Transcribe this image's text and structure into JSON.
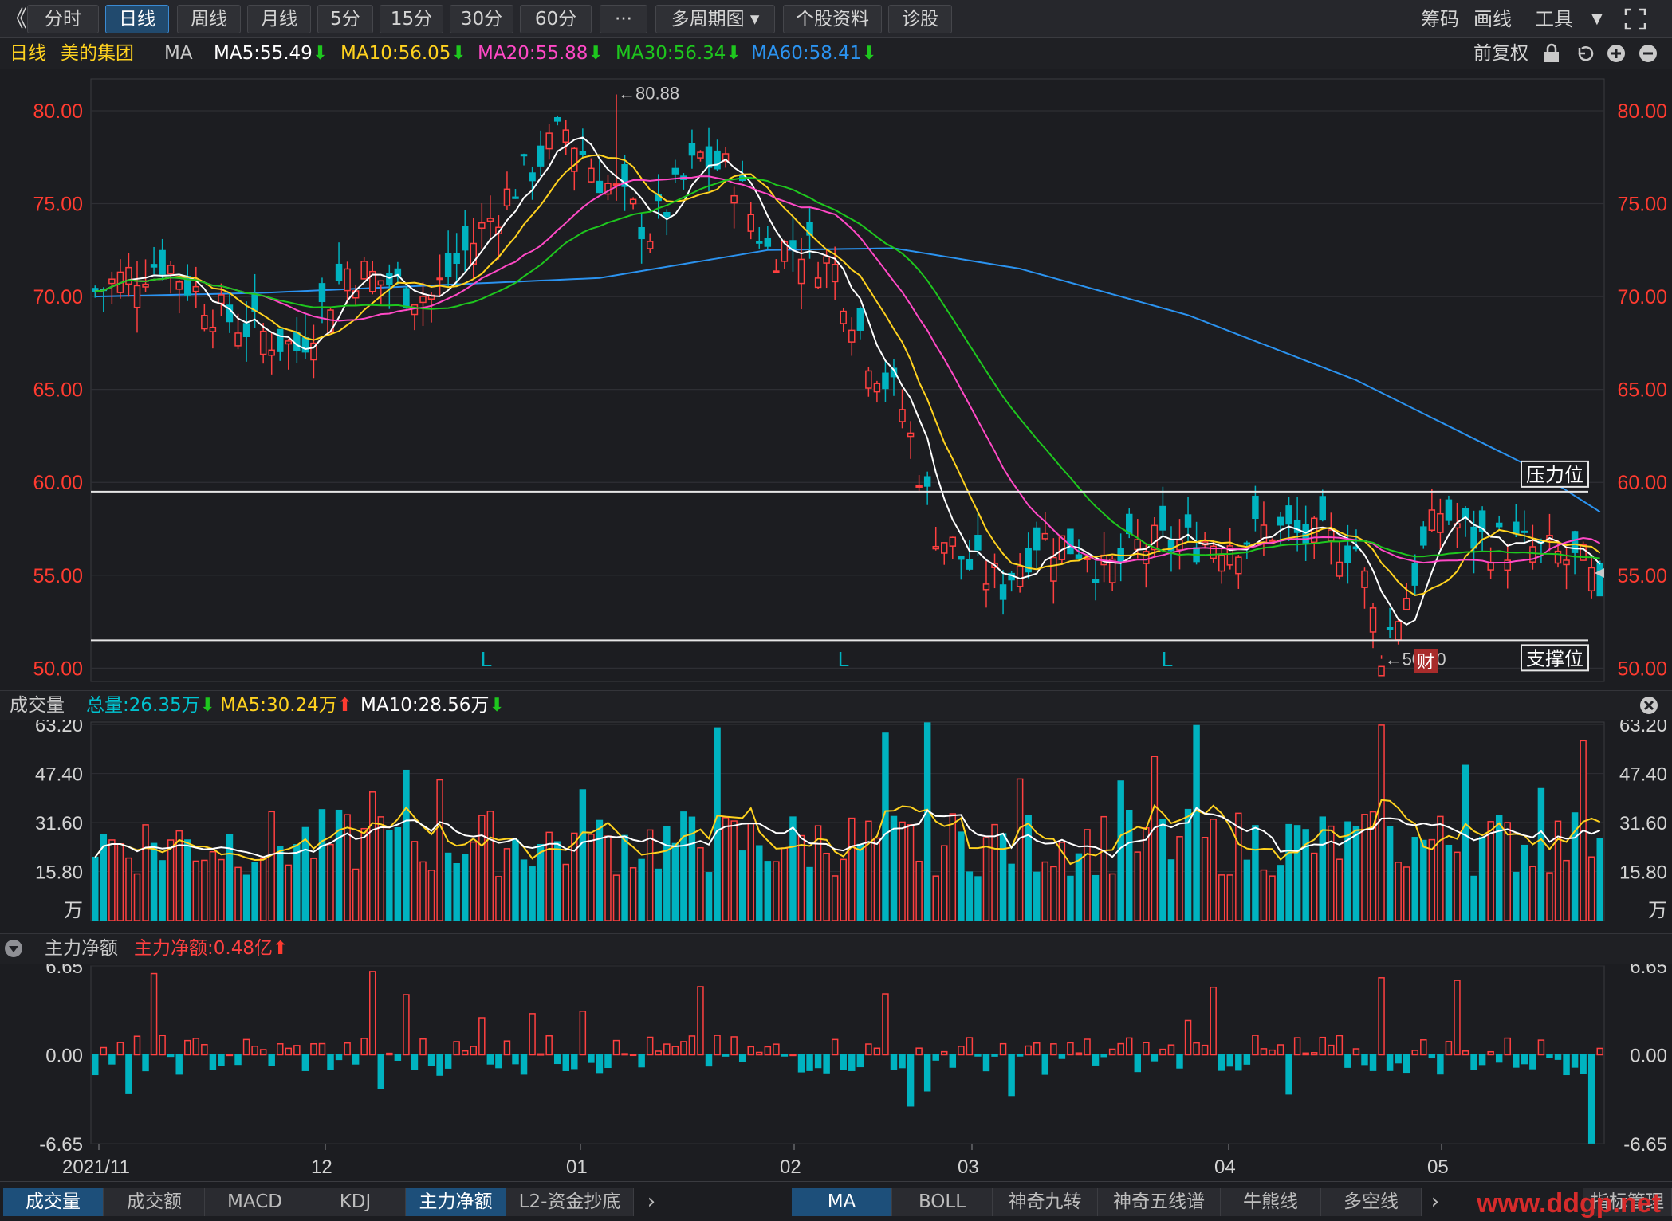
{
  "toolbar": {
    "collapse_icon": "double-chevron-left-icon",
    "tabs": [
      "分时",
      "日线",
      "周线",
      "月线",
      "5分",
      "15分",
      "30分",
      "60分",
      "···",
      "多周期图",
      "个股资料",
      "诊股"
    ],
    "active": "日线",
    "right": [
      "筹码",
      "画线",
      "工具"
    ],
    "fullscreen_icon": "fullscreen-icon"
  },
  "info": {
    "period": "日线",
    "stock": "美的集团",
    "indicator": "MA",
    "ma5": "MA5:55.49",
    "ma10": "MA10:56.05",
    "ma20": "MA20:55.88",
    "ma30": "MA30:56.34",
    "ma60": "MA60:58.41",
    "adjust": "前复权"
  },
  "colors": {
    "up": "#ff4040",
    "down": "#00b3c0",
    "ma5": "#ffffff",
    "ma10": "#ffd21f",
    "ma20": "#ff49c6",
    "ma30": "#1ec71e",
    "ma60": "#2b93f0",
    "axis": "#ff3b30",
    "grid": "#2e2f34"
  },
  "price_axis": [
    "80.00",
    "75.00",
    "70.00",
    "65.00",
    "60.00",
    "55.00",
    "50.00"
  ],
  "price_annot": {
    "high": "←80.88",
    "low": "←50.50",
    "resistance": "压力位",
    "support": "支撑位",
    "markers": [
      "L",
      "L",
      "L"
    ],
    "fin": "财"
  },
  "volume": {
    "title": "成交量",
    "total": "总量:26.35万",
    "ma5": "MA5:30.24万",
    "ma10": "MA10:28.56万",
    "axis": [
      "63.20",
      "47.40",
      "31.60",
      "15.80",
      "万"
    ],
    "close_icon": "close-circle-icon"
  },
  "flow": {
    "title": "主力净额",
    "value": "主力净额:0.48亿",
    "axis": [
      "6.65",
      "0.00",
      "-6.65"
    ],
    "collapse_icon": "triangle-down-icon"
  },
  "dates": [
    "2021/11",
    "12",
    "01",
    "02",
    "03",
    "04",
    "05"
  ],
  "bottom_left": [
    "成交量",
    "成交额",
    "MACD",
    "KDJ",
    "主力净额",
    "L2-资金抄底"
  ],
  "bottom_right": [
    "MA",
    "BOLL",
    "神奇九转",
    "神奇五线谱",
    "牛熊线",
    "多空线"
  ],
  "bottom_end": "指标管理",
  "watermark": "www.ddgp.net",
  "chart_data": [
    {
      "type": "candlestick",
      "title": "日线 美的集团",
      "y_range": [
        49.5,
        81.5
      ],
      "ticks": [
        80,
        75,
        70,
        65,
        60,
        55,
        50
      ],
      "levels": {
        "resistance": 59.5,
        "support": 51.5
      },
      "extremes": {
        "high": 80.88,
        "low": 50.5
      },
      "ma_closes": {
        "MA5": 55.49,
        "MA10": 56.05,
        "MA20": 55.88,
        "MA30": 56.34,
        "MA60": 58.41
      },
      "keypoints": [
        [
          0,
          70.3
        ],
        [
          8,
          72.0
        ],
        [
          15,
          69.0
        ],
        [
          24,
          67.2
        ],
        [
          30,
          71.5
        ],
        [
          40,
          70.0
        ],
        [
          50,
          76.0
        ],
        [
          56,
          79.0
        ],
        [
          60,
          76.5
        ],
        [
          66,
          73.5
        ],
        [
          72,
          77.5
        ],
        [
          76,
          76.5
        ],
        [
          80,
          72.5
        ],
        [
          84,
          72.8
        ],
        [
          88,
          71.5
        ],
        [
          92,
          67.0
        ],
        [
          96,
          64.0
        ],
        [
          100,
          57.5
        ],
        [
          104,
          55.5
        ],
        [
          108,
          54.5
        ],
        [
          112,
          57.0
        ],
        [
          118,
          56.5
        ],
        [
          120,
          55.0
        ],
        [
          124,
          56.5
        ],
        [
          130,
          56.8
        ],
        [
          136,
          57.0
        ],
        [
          140,
          57.5
        ],
        [
          144,
          57.0
        ],
        [
          150,
          56.5
        ],
        [
          153,
          51.0
        ],
        [
          156,
          54.0
        ],
        [
          160,
          58.5
        ],
        [
          164,
          57.0
        ],
        [
          170,
          56.5
        ],
        [
          174,
          56.0
        ],
        [
          177,
          55.5
        ],
        [
          179,
          53.9
        ]
      ],
      "ma60_keypoints": [
        [
          0,
          70.0
        ],
        [
          20,
          70.2
        ],
        [
          60,
          71.0
        ],
        [
          80,
          72.5
        ],
        [
          95,
          72.6
        ],
        [
          110,
          71.5
        ],
        [
          130,
          69.0
        ],
        [
          150,
          65.5
        ],
        [
          170,
          61.0
        ],
        [
          179,
          58.41
        ]
      ]
    },
    {
      "type": "bar",
      "title": "成交量",
      "unit": "万",
      "y_range": [
        0,
        64
      ],
      "ticks": [
        63.2,
        47.4,
        31.6,
        15.8
      ],
      "values_note": "per-day volume in 万 (approximate, 180 bars)"
    },
    {
      "type": "bar",
      "title": "主力净额",
      "unit": "亿",
      "y_range": [
        -6.65,
        6.65
      ],
      "ticks": [
        6.65,
        0,
        -6.65
      ]
    }
  ]
}
